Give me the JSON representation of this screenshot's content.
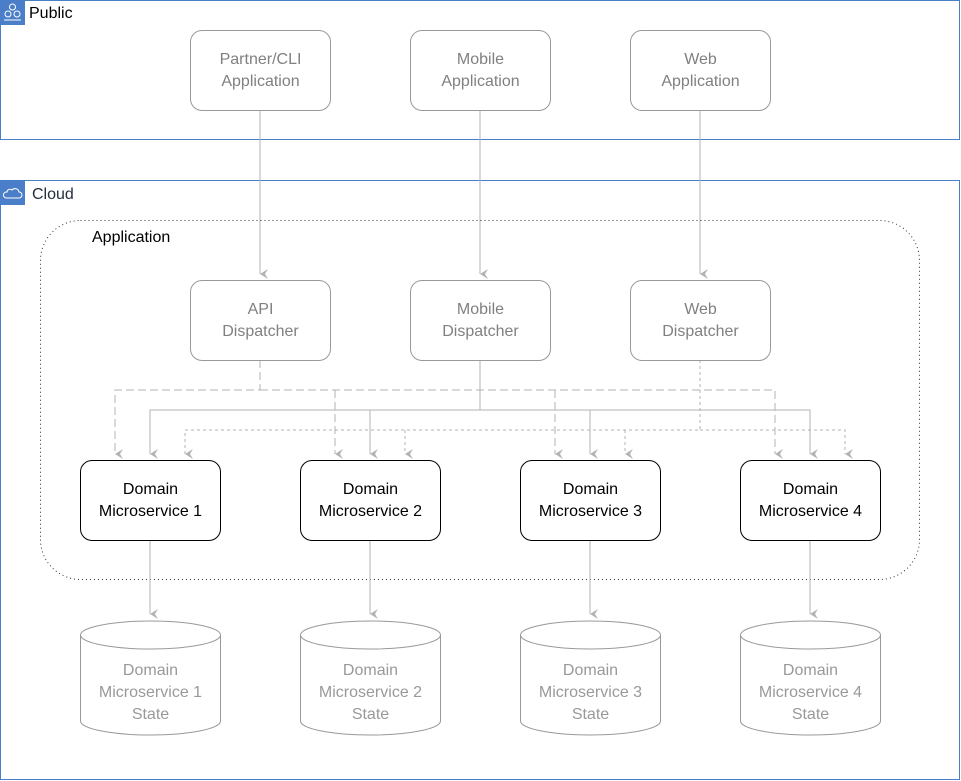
{
  "groups": {
    "public": {
      "label": "Public",
      "icon": "users-group-icon"
    },
    "cloud": {
      "label": "Cloud",
      "icon": "cloud-icon"
    },
    "application": {
      "label": "Application"
    }
  },
  "clients": [
    {
      "label": "Partner/CLI\nApplication"
    },
    {
      "label": "Mobile\nApplication"
    },
    {
      "label": "Web\nApplication"
    }
  ],
  "dispatchers": [
    {
      "label": "API\nDispatcher"
    },
    {
      "label": "Mobile\nDispatcher"
    },
    {
      "label": "Web\nDispatcher"
    }
  ],
  "microservices": [
    {
      "label": "Domain\nMicroservice 1"
    },
    {
      "label": "Domain\nMicroservice 2"
    },
    {
      "label": "Domain\nMicroservice 3"
    },
    {
      "label": "Domain\nMicroservice 4"
    }
  ],
  "stores": [
    {
      "label": "Domain\nMicroservice 1\nState"
    },
    {
      "label": "Domain\nMicroservice 2\nState"
    },
    {
      "label": "Domain\nMicroservice 3\nState"
    },
    {
      "label": "Domain\nMicroservice 4\nState"
    }
  ],
  "colors": {
    "frame": "#4A7EC8",
    "edge": "#B3B3B3",
    "grey_text": "#808080"
  }
}
